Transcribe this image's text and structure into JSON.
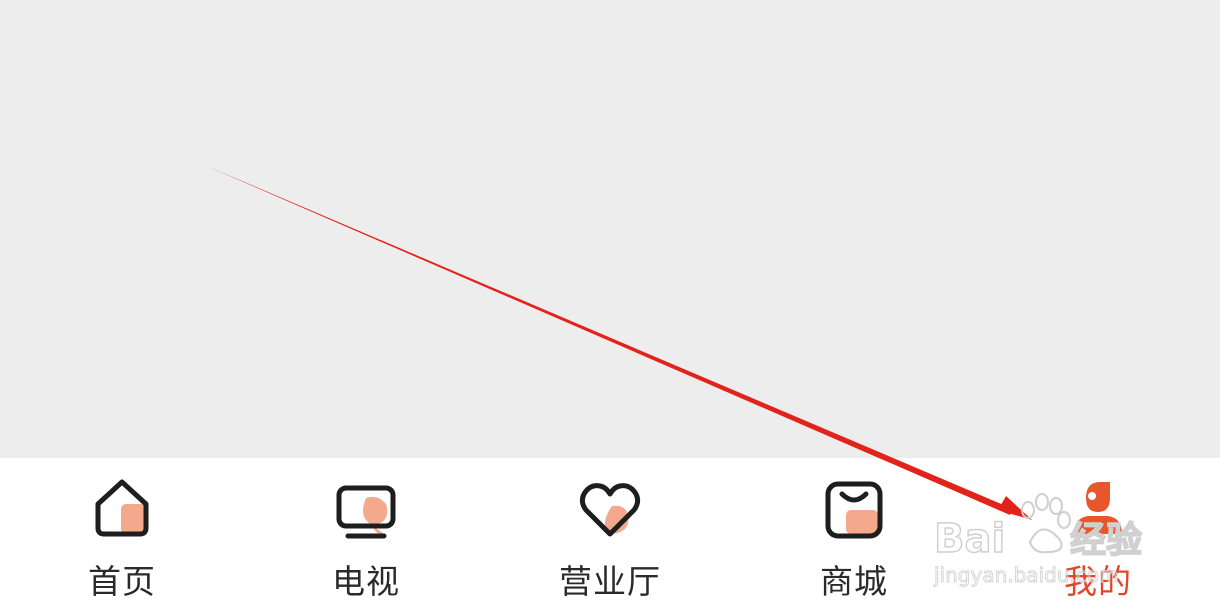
{
  "tabbar": {
    "tabs": [
      {
        "label": "首页",
        "icon": "home-icon"
      },
      {
        "label": "电视",
        "icon": "tv-icon"
      },
      {
        "label": "营业厅",
        "icon": "heart-icon"
      },
      {
        "label": "商城",
        "icon": "shopping-bag-icon"
      },
      {
        "label": "我的",
        "icon": "user-icon",
        "active": true
      }
    ]
  },
  "colors": {
    "accent": "#e2462a",
    "icon_fill": "#f4a88c",
    "icon_stroke": "#1e1e1e",
    "content_bg": "#eeedee",
    "annotation_arrow": "#e2231a"
  },
  "watermark": {
    "brand": "Baidu经验",
    "url": "jingyan.baidu.com"
  }
}
